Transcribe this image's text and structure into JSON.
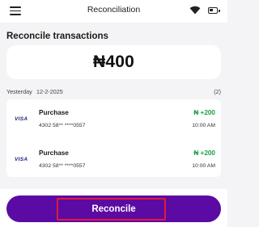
{
  "header": {
    "title": "Reconciliation",
    "menu_icon": "hamburger-menu-icon",
    "wifi_icon": "wifi-icon",
    "battery_icon": "battery-icon"
  },
  "section": {
    "title": "Reconcile transactions"
  },
  "summary": {
    "amount": "₦400"
  },
  "group": {
    "day": "Yesterday",
    "date": "12-2-2025",
    "count": "(2)"
  },
  "transactions": [
    {
      "brand": "VISA",
      "title": "Purchase",
      "card": "4302 58** ****0557",
      "amount": "₦ +200",
      "time": "10:00 AM"
    },
    {
      "brand": "VISA",
      "title": "Purchase",
      "card": "4302 58** ****0557",
      "amount": "₦ +200",
      "time": "10:00 AM"
    }
  ],
  "actions": {
    "reconcile_label": "Reconcile"
  },
  "colors": {
    "primary": "#5b0aa3",
    "positive": "#1fa046",
    "highlight": "#e21a3a",
    "background": "#f4f4f6"
  }
}
